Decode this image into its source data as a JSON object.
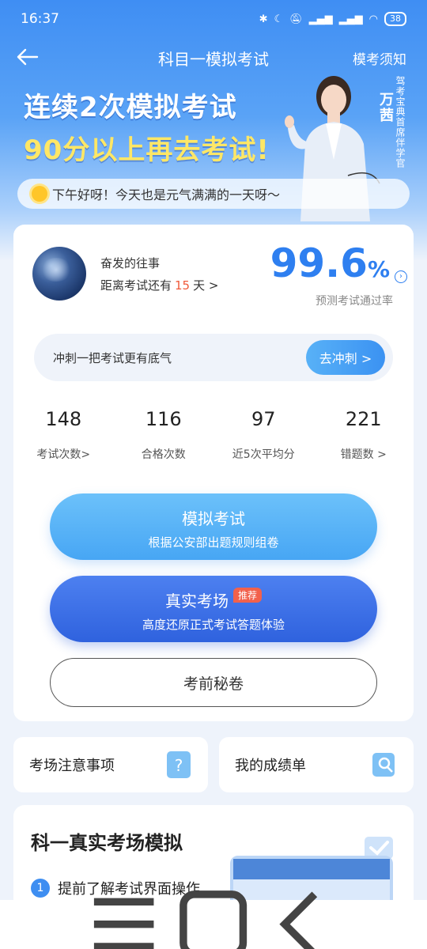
{
  "status_bar": {
    "time": "16:37",
    "battery": "38"
  },
  "nav": {
    "title": "科目一模拟考试",
    "right_link": "模考须知"
  },
  "banner": {
    "line1": "连续2次模拟考试",
    "line2": "90分以上再去考试!",
    "presenter_name": "万茜",
    "presenter_title": "驾考宝典首席伴学官"
  },
  "greeting": "下午好呀！今天也是元气满满的一天呀～",
  "profile": {
    "username": "奋发的往事",
    "countdown_prefix": "距离考试还有",
    "countdown_days": "15",
    "countdown_suffix": "天 >"
  },
  "pass_rate": {
    "value": "99.6",
    "unit": "%",
    "label": "预测考试通过率"
  },
  "sprint": {
    "text": "冲刺一把考试更有底气",
    "button": "去冲刺 >"
  },
  "stats": [
    {
      "value": "148",
      "label": "考试次数>"
    },
    {
      "value": "116",
      "label": "合格次数"
    },
    {
      "value": "97",
      "label": "近5次平均分"
    },
    {
      "value": "221",
      "label": "错题数 >"
    }
  ],
  "actions": {
    "mock_title": "模拟考试",
    "mock_sub": "根据公安部出题规则组卷",
    "real_title": "真实考场",
    "real_tag": "推荐",
    "real_sub": "高度还原正式考试答题体验",
    "secret": "考前秘卷"
  },
  "mini_cards": {
    "notice": "考场注意事项",
    "report": "我的成绩单"
  },
  "bottom": {
    "title": "科一真实考场模拟",
    "item_num": "1",
    "item_text": "提前了解考试界面操作"
  },
  "colors": {
    "accent": "#2e7ff0",
    "countdown": "#f05a3a",
    "banner_yellow": "#ffe766"
  }
}
